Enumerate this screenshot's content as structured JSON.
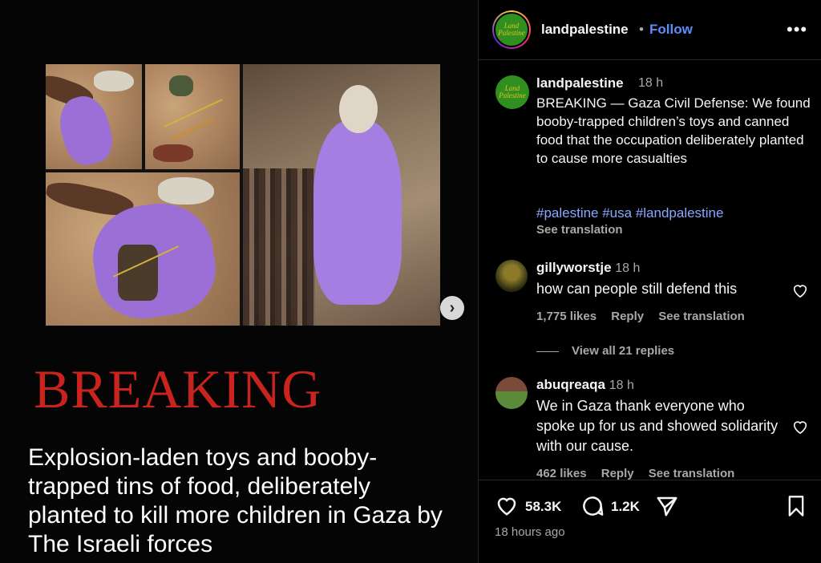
{
  "post": {
    "breaking_title": "BREAKING",
    "image_caption": "Explosion-laden toys and booby-trapped tins of food, deliberately planted to kill more children in Gaza by The Israeli forces",
    "next_icon": "chevron-right-icon"
  },
  "header": {
    "username": "landpalestine",
    "separator": "•",
    "follow_label": "Follow",
    "more_label": "•••",
    "logo_text": "Land Palestine"
  },
  "caption": {
    "username": "landpalestine",
    "time": "18 h",
    "text": "BREAKING — Gaza Civil Defense: We found booby-trapped children’s toys and canned food that the occupation deliberately planted to cause more casualties",
    "hashtags": "#palestine #usa #landpalestine",
    "see_translation": "See translation"
  },
  "comments": [
    {
      "username": "gillyworstje",
      "time": "18 h",
      "text": "how can people still defend this",
      "likes": "1,775 likes",
      "reply": "Reply",
      "see_translation": "See translation"
    },
    {
      "username": "abuqreaqa",
      "time": "18 h",
      "text": "We in Gaza thank everyone who spoke up for us and showed solidarity with our cause.",
      "likes": "462 likes",
      "reply": "Reply",
      "see_translation": "See translation"
    }
  ],
  "view_replies": "View all 21 replies",
  "actions": {
    "likes": "58.3K",
    "comments": "1.2K",
    "timestamp": "18 hours ago"
  },
  "colors": {
    "breaking_red": "#c8241d",
    "follow_blue": "#5c8dfa",
    "hashtag": "#8aa7ff",
    "muted": "#a8a8a8"
  }
}
